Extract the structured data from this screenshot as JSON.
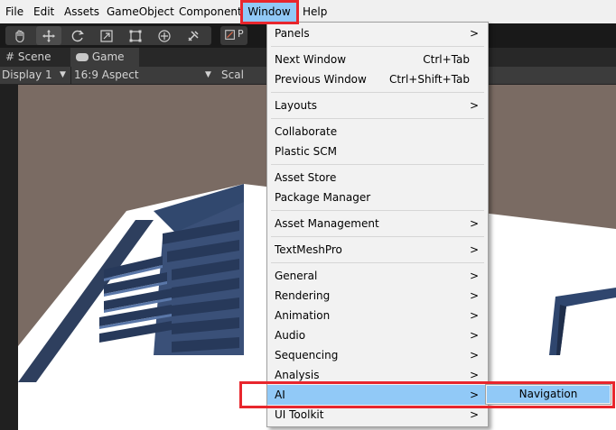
{
  "menubar": {
    "items": [
      "File",
      "Edit",
      "Assets",
      "GameObject",
      "Component",
      "Window",
      "Help"
    ],
    "active": "Window"
  },
  "toolbar": {
    "tools": [
      "hand-tool",
      "move-tool",
      "rotate-tool",
      "scale-tool",
      "rect-tool",
      "transform-tool",
      "custom-tool"
    ],
    "active_tool": "move-tool",
    "pivot_label": "P"
  },
  "tabs": [
    {
      "label": "Scene",
      "icon": "hash-icon"
    },
    {
      "label": "Game",
      "icon": "gamepad-icon"
    }
  ],
  "gamebar": {
    "display": "Display 1",
    "aspect": "16:9 Aspect",
    "scale_label": "Scal"
  },
  "window_menu": {
    "items": [
      {
        "label": "Panels",
        "submenu": true
      },
      {
        "label": "Next Window",
        "shortcut": "Ctrl+Tab"
      },
      {
        "label": "Previous Window",
        "shortcut": "Ctrl+Shift+Tab"
      },
      {
        "label": "Layouts",
        "submenu": true
      },
      {
        "label": "Collaborate"
      },
      {
        "label": "Plastic SCM"
      },
      {
        "label": "Asset Store"
      },
      {
        "label": "Package Manager"
      },
      {
        "label": "Asset Management",
        "submenu": true
      },
      {
        "label": "TextMeshPro",
        "submenu": true
      },
      {
        "label": "General",
        "submenu": true
      },
      {
        "label": "Rendering",
        "submenu": true
      },
      {
        "label": "Animation",
        "submenu": true
      },
      {
        "label": "Audio",
        "submenu": true
      },
      {
        "label": "Sequencing",
        "submenu": true
      },
      {
        "label": "Analysis",
        "submenu": true
      },
      {
        "label": "AI",
        "submenu": true,
        "highlighted": true
      },
      {
        "label": "UI Toolkit",
        "submenu": true
      }
    ],
    "arrow_glyph": ">"
  },
  "ai_submenu": {
    "items": [
      {
        "label": "Navigation",
        "highlighted": true
      }
    ]
  },
  "colors": {
    "highlight": "#91c9f7",
    "annotation_red": "#e8262d",
    "menu_bg": "#f2f2f2"
  }
}
